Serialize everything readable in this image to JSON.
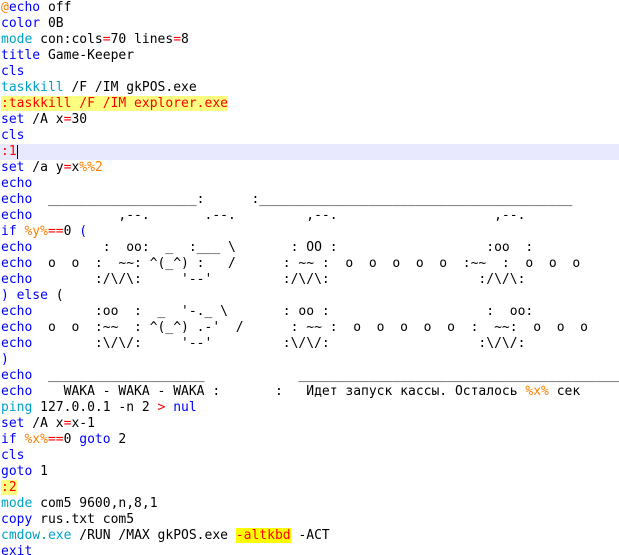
{
  "lines": [
    [
      [
        "at",
        "@"
      ],
      [
        "kw",
        "echo"
      ],
      [
        "text",
        " off"
      ]
    ],
    [
      [
        "kw",
        "color"
      ],
      [
        "text",
        " 0B"
      ]
    ],
    [
      [
        "cmd",
        "mode"
      ],
      [
        "text",
        " con:cols"
      ],
      [
        "op",
        "="
      ],
      [
        "text",
        "70 lines"
      ],
      [
        "op",
        "="
      ],
      [
        "text",
        "8"
      ]
    ],
    [
      [
        "kw",
        "title"
      ],
      [
        "text",
        " Game-Keeper"
      ]
    ],
    [
      [
        "kw",
        "cls"
      ]
    ],
    [
      [
        "cmd",
        "taskkill"
      ],
      [
        "text",
        " /F /IM gkPOS.exe"
      ]
    ],
    [
      [
        "label",
        ":taskkill /F /IM explorer.exe",
        true
      ]
    ],
    [
      [
        "kw",
        "set"
      ],
      [
        "text",
        " /A x"
      ],
      [
        "op",
        "="
      ],
      [
        "text",
        "30"
      ]
    ],
    [
      [
        "kw",
        "cls"
      ]
    ],
    [
      [
        "label",
        ":1"
      ]
    ],
    [
      [
        "kw",
        "set"
      ],
      [
        "text",
        " /a y"
      ],
      [
        "op",
        "="
      ],
      [
        "text",
        "x"
      ],
      [
        "var",
        "%%2"
      ]
    ],
    [
      [
        "kw",
        "echo"
      ]
    ],
    [
      [
        "kw",
        "echo"
      ],
      [
        "text",
        "  ___________________:      :________________________________________"
      ]
    ],
    [
      [
        "kw",
        "echo"
      ],
      [
        "text",
        "           ,--.       .--.         ,--.                    ,--."
      ]
    ],
    [
      [
        "kw",
        "if"
      ],
      [
        "text",
        " "
      ],
      [
        "var",
        "%y%"
      ],
      [
        "op",
        "=="
      ],
      [
        "text",
        "0 "
      ],
      [
        "kw",
        "("
      ]
    ],
    [
      [
        "kw",
        "echo"
      ],
      [
        "text",
        "         :  oo:  _  :___ \\       : OO :                   :oo  :"
      ]
    ],
    [
      [
        "kw",
        "echo"
      ],
      [
        "text",
        "  o  o  :  ~~: ^(_^) :   /      : ~~ :  o  o  o  o  o  :~~  :  o  o  o"
      ]
    ],
    [
      [
        "kw",
        "echo"
      ],
      [
        "text",
        "        :/\\/\\:     '--'         :/\\/\\:                   :/\\/\\:"
      ]
    ],
    [
      [
        "kw",
        ")"
      ],
      [
        "text",
        " "
      ],
      [
        "kw",
        "else"
      ],
      [
        "text",
        " ("
      ]
    ],
    [
      [
        "kw",
        "echo"
      ],
      [
        "text",
        "        :oo  :  _  '-._ \\       : oo :                    :  oo:"
      ]
    ],
    [
      [
        "kw",
        "echo"
      ],
      [
        "text",
        "  o  o  :~~  : ^(_^) .-'  /      : ~~ :  o  o  o  o  o  :  ~~:  o  o  o"
      ]
    ],
    [
      [
        "kw",
        "echo"
      ],
      [
        "text",
        "        :\\/\\/:     '--'         :\\/\\/:                   :\\/\\/:"
      ]
    ],
    [
      [
        "kw",
        ")"
      ]
    ],
    [
      [
        "kw",
        "echo"
      ],
      [
        "text",
        "  ____________________            _________________________________________"
      ]
    ],
    [
      [
        "kw",
        "echo"
      ],
      [
        "text",
        "    WAKA - WAKA - WAKA :       :   Идет запуск кассы. Осталось "
      ],
      [
        "var",
        "%x%"
      ],
      [
        "text",
        " сек"
      ]
    ],
    [
      [
        "cmd",
        "ping"
      ],
      [
        "text",
        " 127.0.0.1 -n 2 "
      ],
      [
        "op",
        ">"
      ],
      [
        "text",
        " "
      ],
      [
        "kw",
        "nul"
      ]
    ],
    [
      [
        "kw",
        "set"
      ],
      [
        "text",
        " /A x"
      ],
      [
        "op",
        "="
      ],
      [
        "text",
        "x-1"
      ]
    ],
    [
      [
        "kw",
        "if"
      ],
      [
        "text",
        " "
      ],
      [
        "var",
        "%x%"
      ],
      [
        "op",
        "=="
      ],
      [
        "text",
        "0 "
      ],
      [
        "kw",
        "goto"
      ],
      [
        "text",
        " 2"
      ]
    ],
    [
      [
        "kw",
        "cls"
      ]
    ],
    [
      [
        "kw",
        "goto"
      ],
      [
        "text",
        " 1"
      ]
    ],
    [
      [
        "label",
        ":2",
        true
      ]
    ],
    [
      [
        "cmd",
        "mode"
      ],
      [
        "text",
        " com5 9600,n,8,1"
      ]
    ],
    [
      [
        "kw",
        "copy"
      ],
      [
        "text",
        " rus.txt com5"
      ]
    ],
    [
      [
        "cmd",
        "cmdow.exe"
      ],
      [
        "text",
        " /RUN /MAX gkPOS.exe "
      ],
      [
        "op",
        "-altkbd",
        true
      ],
      [
        "text",
        " -ACT"
      ]
    ],
    [
      [
        "kw",
        "exit"
      ]
    ]
  ],
  "current_line": 9,
  "colors": {
    "keyword": "#0000ff",
    "command": "#00a0c8",
    "operator": "#ff0000",
    "variable": "#ff8000",
    "label": "#ff0000",
    "highlight": "#ffff80",
    "current_line": "#e8e8ff"
  }
}
